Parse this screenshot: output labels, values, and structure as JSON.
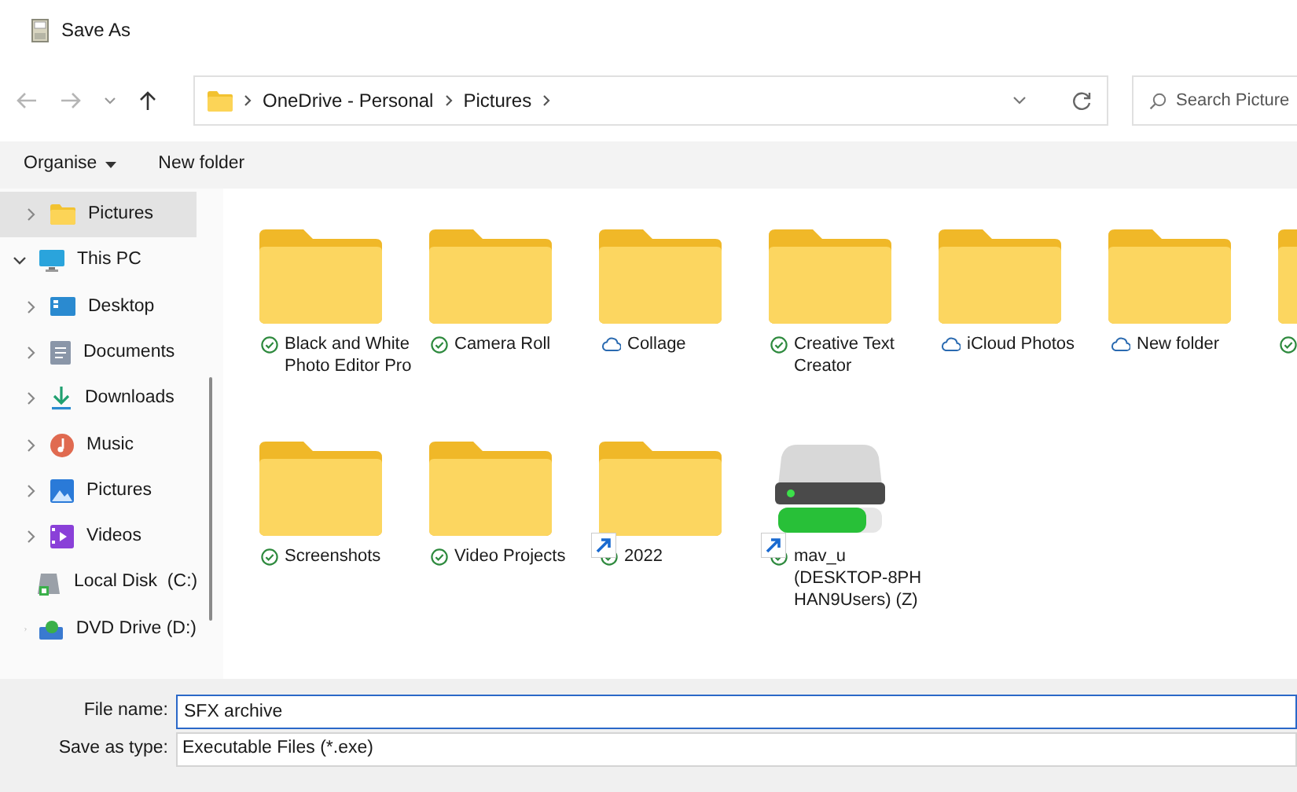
{
  "window": {
    "title": "Save As"
  },
  "nav": {
    "back_disabled": true,
    "forward_disabled": true
  },
  "address": {
    "crumbs": [
      "OneDrive - Personal",
      "Pictures"
    ]
  },
  "search": {
    "placeholder": "Search Picture"
  },
  "toolbar": {
    "organise": "Organise",
    "new_folder": "New folder"
  },
  "sidebar": {
    "items": [
      {
        "label": "Pictures",
        "kind": "folder",
        "selected": true,
        "expanded": false,
        "indent": true
      },
      {
        "label": "This PC",
        "kind": "pc",
        "selected": false,
        "expanded": true,
        "children": [
          {
            "label": "Desktop",
            "kind": "desktop",
            "selected": false,
            "expanded": false
          },
          {
            "label": "Documents",
            "kind": "documents",
            "selected": false,
            "expanded": false
          },
          {
            "label": "Downloads",
            "kind": "downloads",
            "selected": false,
            "expanded": false
          },
          {
            "label": "Music",
            "kind": "music",
            "selected": false,
            "expanded": false
          },
          {
            "label": "Pictures",
            "kind": "pictures",
            "selected": false,
            "expanded": false
          },
          {
            "label": "Videos",
            "kind": "videos",
            "selected": false,
            "expanded": false
          },
          {
            "label": "Local Disk  (C:)",
            "kind": "disk",
            "selected": false,
            "expanded": false
          },
          {
            "label": "DVD Drive (D:)",
            "kind": "dvd",
            "selected": false,
            "expanded": false
          }
        ]
      }
    ]
  },
  "files": [
    {
      "kind": "folder",
      "name": "Black and White Photo Editor Pro",
      "synced": true,
      "shortcut": false
    },
    {
      "kind": "folder",
      "name": "Camera Roll",
      "synced": true,
      "shortcut": false
    },
    {
      "kind": "folder",
      "name": "Collage",
      "synced": false,
      "shortcut": false
    },
    {
      "kind": "folder",
      "name": "Creative Text Creator",
      "synced": true,
      "shortcut": false
    },
    {
      "kind": "folder",
      "name": "iCloud Photos",
      "synced": false,
      "shortcut": false
    },
    {
      "kind": "folder",
      "name": "New folder",
      "synced": false,
      "shortcut": false
    },
    {
      "kind": "folder",
      "synced": true,
      "shortcut": false
    },
    {
      "kind": "folder",
      "name": "Screenshots",
      "synced": true,
      "shortcut": false
    },
    {
      "kind": "folder",
      "name": "Video Projects",
      "synced": true,
      "shortcut": false
    },
    {
      "kind": "folder",
      "name": "2022",
      "synced": true,
      "shortcut": true
    },
    {
      "kind": "drive",
      "name": "mav_u (DESKTOP-8PH HAN9Users) (Z)",
      "synced": true,
      "shortcut": true
    }
  ],
  "form": {
    "file_name_label": "File name:",
    "file_name": "SFX archive",
    "type_label": "Save as type:",
    "type": "Executable Files (*.exe)"
  }
}
